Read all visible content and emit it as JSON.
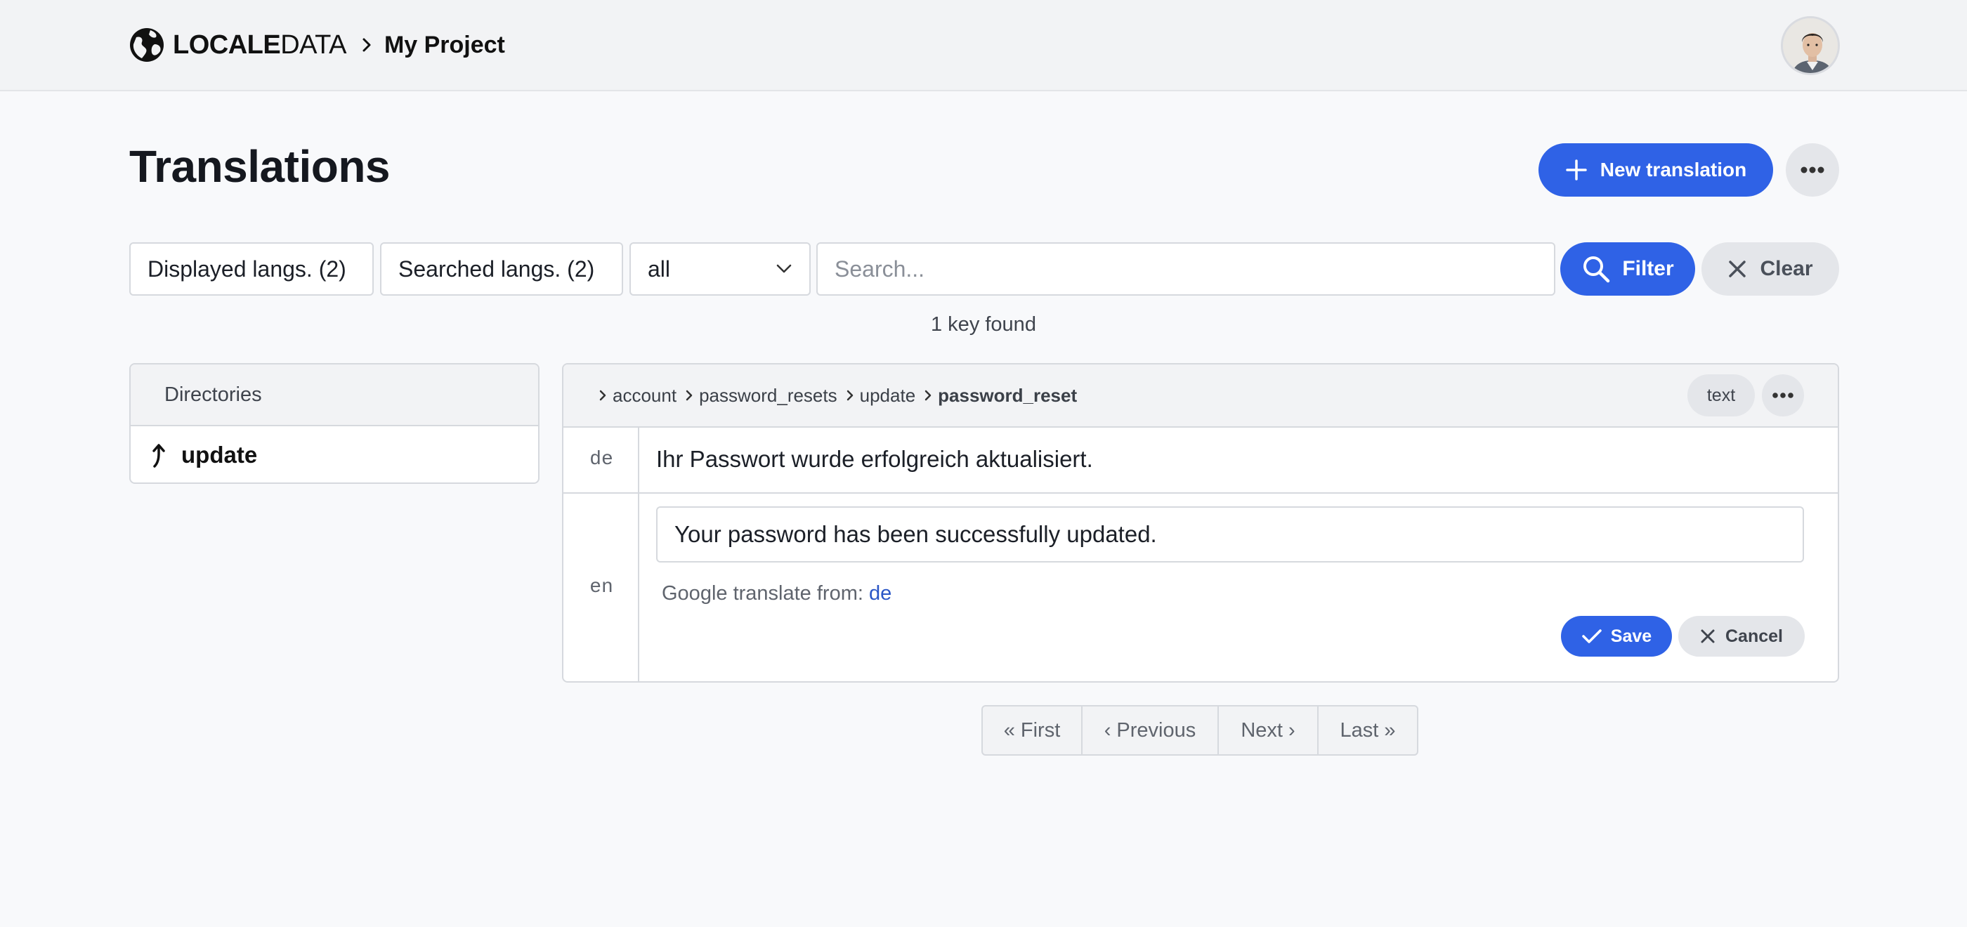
{
  "header": {
    "brand_bold": "LOCALE",
    "brand_light": "DATA",
    "project": "My Project"
  },
  "page": {
    "title": "Translations",
    "new_button": "New translation"
  },
  "filters": {
    "displayed_langs": "Displayed langs. (2)",
    "searched_langs": "Searched langs. (2)",
    "scope_selected": "all",
    "search_placeholder": "Search...",
    "filter_button": "Filter",
    "clear_button": "Clear",
    "results_text": "1 key found"
  },
  "directories": {
    "heading": "Directories",
    "items": [
      {
        "label": "update"
      }
    ]
  },
  "key": {
    "path": [
      "account",
      "password_resets",
      "update"
    ],
    "name": "password_reset",
    "type_badge": "text"
  },
  "translations": {
    "de": {
      "lang": "de",
      "text": "Ihr Passwort wurde erfolgreich aktualisiert."
    },
    "en": {
      "lang": "en",
      "value": "Your password has been successfully updated.",
      "google_label": "Google translate from:",
      "google_link": "de",
      "save": "Save",
      "cancel": "Cancel"
    }
  },
  "pagination": {
    "first": "« First",
    "previous": "‹ Previous",
    "next": "Next ›",
    "last": "Last »"
  },
  "colors": {
    "primary": "#2f62e6",
    "background": "#f8f9fb",
    "header_bg": "#f2f3f5",
    "link": "#2a56c6"
  }
}
